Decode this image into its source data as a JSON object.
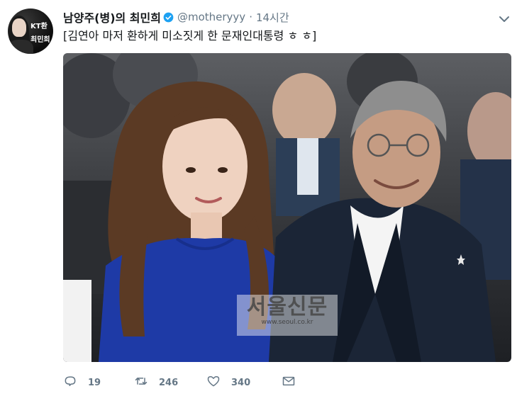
{
  "avatar": {
    "label_lines": [
      "KT환",
      "최민희"
    ]
  },
  "header": {
    "name": "남양주(병)의 최민희",
    "handle": "@motheryyy",
    "separator": "·",
    "time": "14시간",
    "verified_color": "#1da1f2"
  },
  "tweet": {
    "text": "[김연아 마저 환하게 미소짓게 한 문재인대통령 ㅎ ㅎ]"
  },
  "photo": {
    "watermark_title": "서울신문",
    "watermark_sub": "www.seoul.co.kr"
  },
  "actions": {
    "reply_count": "19",
    "retweet_count": "246",
    "like_count": "340",
    "icon_color": "#657786"
  }
}
